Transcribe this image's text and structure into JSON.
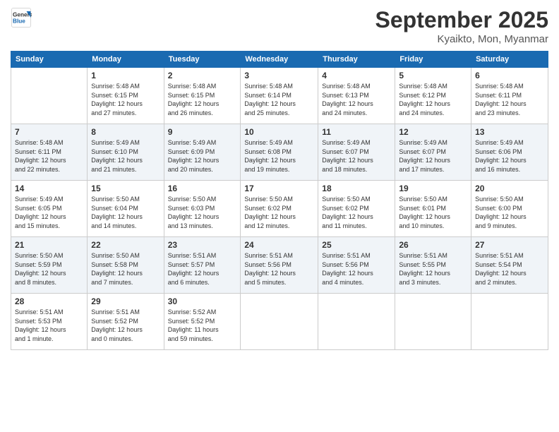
{
  "header": {
    "logo_line1": "General",
    "logo_line2": "Blue",
    "month": "September 2025",
    "location": "Kyaikto, Mon, Myanmar"
  },
  "weekdays": [
    "Sunday",
    "Monday",
    "Tuesday",
    "Wednesday",
    "Thursday",
    "Friday",
    "Saturday"
  ],
  "weeks": [
    [
      {
        "day": "",
        "info": ""
      },
      {
        "day": "1",
        "info": "Sunrise: 5:48 AM\nSunset: 6:15 PM\nDaylight: 12 hours\nand 27 minutes."
      },
      {
        "day": "2",
        "info": "Sunrise: 5:48 AM\nSunset: 6:15 PM\nDaylight: 12 hours\nand 26 minutes."
      },
      {
        "day": "3",
        "info": "Sunrise: 5:48 AM\nSunset: 6:14 PM\nDaylight: 12 hours\nand 25 minutes."
      },
      {
        "day": "4",
        "info": "Sunrise: 5:48 AM\nSunset: 6:13 PM\nDaylight: 12 hours\nand 24 minutes."
      },
      {
        "day": "5",
        "info": "Sunrise: 5:48 AM\nSunset: 6:12 PM\nDaylight: 12 hours\nand 24 minutes."
      },
      {
        "day": "6",
        "info": "Sunrise: 5:48 AM\nSunset: 6:11 PM\nDaylight: 12 hours\nand 23 minutes."
      }
    ],
    [
      {
        "day": "7",
        "info": "Sunrise: 5:48 AM\nSunset: 6:11 PM\nDaylight: 12 hours\nand 22 minutes."
      },
      {
        "day": "8",
        "info": "Sunrise: 5:49 AM\nSunset: 6:10 PM\nDaylight: 12 hours\nand 21 minutes."
      },
      {
        "day": "9",
        "info": "Sunrise: 5:49 AM\nSunset: 6:09 PM\nDaylight: 12 hours\nand 20 minutes."
      },
      {
        "day": "10",
        "info": "Sunrise: 5:49 AM\nSunset: 6:08 PM\nDaylight: 12 hours\nand 19 minutes."
      },
      {
        "day": "11",
        "info": "Sunrise: 5:49 AM\nSunset: 6:07 PM\nDaylight: 12 hours\nand 18 minutes."
      },
      {
        "day": "12",
        "info": "Sunrise: 5:49 AM\nSunset: 6:07 PM\nDaylight: 12 hours\nand 17 minutes."
      },
      {
        "day": "13",
        "info": "Sunrise: 5:49 AM\nSunset: 6:06 PM\nDaylight: 12 hours\nand 16 minutes."
      }
    ],
    [
      {
        "day": "14",
        "info": "Sunrise: 5:49 AM\nSunset: 6:05 PM\nDaylight: 12 hours\nand 15 minutes."
      },
      {
        "day": "15",
        "info": "Sunrise: 5:50 AM\nSunset: 6:04 PM\nDaylight: 12 hours\nand 14 minutes."
      },
      {
        "day": "16",
        "info": "Sunrise: 5:50 AM\nSunset: 6:03 PM\nDaylight: 12 hours\nand 13 minutes."
      },
      {
        "day": "17",
        "info": "Sunrise: 5:50 AM\nSunset: 6:02 PM\nDaylight: 12 hours\nand 12 minutes."
      },
      {
        "day": "18",
        "info": "Sunrise: 5:50 AM\nSunset: 6:02 PM\nDaylight: 12 hours\nand 11 minutes."
      },
      {
        "day": "19",
        "info": "Sunrise: 5:50 AM\nSunset: 6:01 PM\nDaylight: 12 hours\nand 10 minutes."
      },
      {
        "day": "20",
        "info": "Sunrise: 5:50 AM\nSunset: 6:00 PM\nDaylight: 12 hours\nand 9 minutes."
      }
    ],
    [
      {
        "day": "21",
        "info": "Sunrise: 5:50 AM\nSunset: 5:59 PM\nDaylight: 12 hours\nand 8 minutes."
      },
      {
        "day": "22",
        "info": "Sunrise: 5:50 AM\nSunset: 5:58 PM\nDaylight: 12 hours\nand 7 minutes."
      },
      {
        "day": "23",
        "info": "Sunrise: 5:51 AM\nSunset: 5:57 PM\nDaylight: 12 hours\nand 6 minutes."
      },
      {
        "day": "24",
        "info": "Sunrise: 5:51 AM\nSunset: 5:56 PM\nDaylight: 12 hours\nand 5 minutes."
      },
      {
        "day": "25",
        "info": "Sunrise: 5:51 AM\nSunset: 5:56 PM\nDaylight: 12 hours\nand 4 minutes."
      },
      {
        "day": "26",
        "info": "Sunrise: 5:51 AM\nSunset: 5:55 PM\nDaylight: 12 hours\nand 3 minutes."
      },
      {
        "day": "27",
        "info": "Sunrise: 5:51 AM\nSunset: 5:54 PM\nDaylight: 12 hours\nand 2 minutes."
      }
    ],
    [
      {
        "day": "28",
        "info": "Sunrise: 5:51 AM\nSunset: 5:53 PM\nDaylight: 12 hours\nand 1 minute."
      },
      {
        "day": "29",
        "info": "Sunrise: 5:51 AM\nSunset: 5:52 PM\nDaylight: 12 hours\nand 0 minutes."
      },
      {
        "day": "30",
        "info": "Sunrise: 5:52 AM\nSunset: 5:52 PM\nDaylight: 11 hours\nand 59 minutes."
      },
      {
        "day": "",
        "info": ""
      },
      {
        "day": "",
        "info": ""
      },
      {
        "day": "",
        "info": ""
      },
      {
        "day": "",
        "info": ""
      }
    ]
  ]
}
